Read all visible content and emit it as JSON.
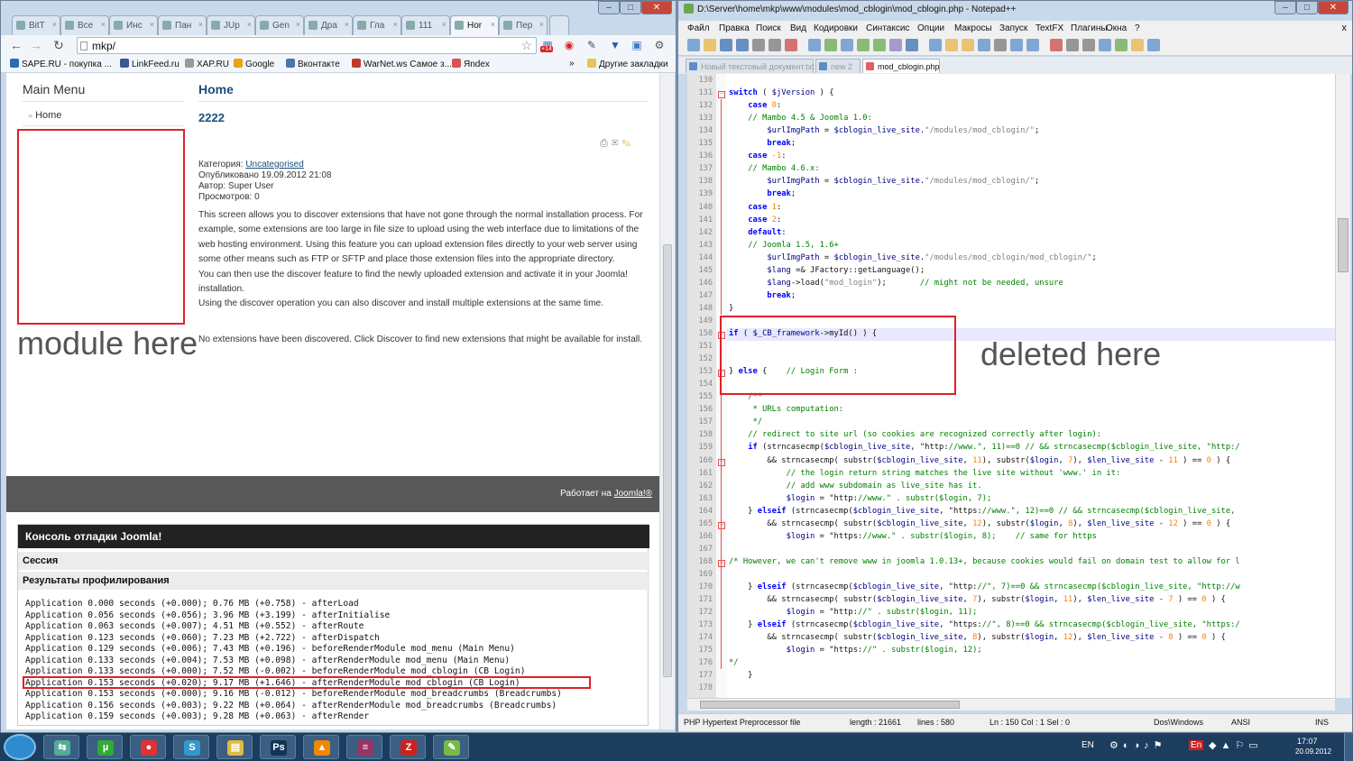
{
  "chrome": {
    "tabs": [
      {
        "label": "BitT"
      },
      {
        "label": "Все"
      },
      {
        "label": "Инс"
      },
      {
        "label": "Пан"
      },
      {
        "label": "JUp"
      },
      {
        "label": "Gen"
      },
      {
        "label": "Дра"
      },
      {
        "label": "Гла"
      },
      {
        "label": "111"
      },
      {
        "label": "Hor"
      },
      {
        "label": "Пер"
      }
    ],
    "url": "mkp/",
    "badge": "+14",
    "bookmarks": [
      {
        "label": "SAPE.RU - покупка ...",
        "color": "#2b6cb0"
      },
      {
        "label": "LinkFeed.ru",
        "color": "#3b5998"
      },
      {
        "label": "XAP.RU",
        "color": "#999999"
      },
      {
        "label": "Google",
        "color": "#e8a317"
      },
      {
        "label": "Вконтакте",
        "color": "#4a76a8"
      },
      {
        "label": "WarNet.ws Самое з...",
        "color": "#c0392b"
      },
      {
        "label": "Яndex",
        "color": "#d9534f"
      }
    ],
    "other_bookmarks": "Другие закладки"
  },
  "joomla": {
    "main_menu_title": "Main Menu",
    "menu_item_home": "Home",
    "module_note": "module here",
    "page_title": "Home",
    "article_title": "2222",
    "category_label": "Категория: ",
    "category_link": "Uncategorised",
    "published": "Опубликовано 19.09.2012 21:08",
    "author": "Автор: Super User",
    "views": "Просмотров: 0",
    "body": [
      "This screen allows you to discover extensions that have not gone through the normal installation process. For example, some extensions are too large in file size to upload using the web interface due to limitations of the web hosting environment. Using this feature you can upload extension files directly to your web server using some other means such as FTP or SFTP and place those extension files into the appropriate directory.",
      "You can then use the discover feature to find the newly uploaded extension and activate it in your Joomla! installation.",
      "Using the discover operation you can also discover and install multiple extensions at the same time."
    ],
    "no_extensions": "No extensions have been discovered. Click Discover to find new extensions that might be available for install.",
    "powered_label": "Работает на ",
    "powered_link": "Joomla!®",
    "debug_title": "Консоль отладки Joomla!",
    "session_label": "Сессия",
    "profile_label": "Результаты профилирования",
    "profile_lines": [
      "Application 0.000 seconds (+0.000); 0.76 MB (+0.758) - afterLoad",
      "Application 0.056 seconds (+0.056); 3.96 MB (+3.199) - afterInitialise",
      "Application 0.063 seconds (+0.007); 4.51 MB (+0.552) - afterRoute",
      "Application 0.123 seconds (+0.060); 7.23 MB (+2.722) - afterDispatch",
      "Application 0.129 seconds (+0.006); 7.43 MB (+0.196) - beforeRenderModule mod_menu (Main Menu)",
      "Application 0.133 seconds (+0.004); 7.53 MB (+0.098) - afterRenderModule mod_menu (Main Menu)",
      "Application 0.133 seconds (+0.000); 7.52 MB (-0.002) - beforeRenderModule mod_cblogin (CB Login)",
      "Application 0.153 seconds (+0.020); 9.17 MB (+1.646) - afterRenderModule mod_cblogin (CB Login)",
      "Application 0.153 seconds (+0.000); 9.16 MB (-0.012) - beforeRenderModule mod_breadcrumbs (Breadcrumbs)",
      "Application 0.156 seconds (+0.003); 9.22 MB (+0.064) - afterRenderModule mod_breadcrumbs (Breadcrumbs)",
      "Application 0.159 seconds (+0.003); 9.28 MB (+0.063) - afterRender"
    ]
  },
  "npp": {
    "title": "D:\\Server\\home\\mkp\\www\\modules\\mod_cblogin\\mod_cblogin.php - Notepad++",
    "menu": [
      "Файл",
      "Правка",
      "Поиск",
      "Вид",
      "Кодировки",
      "Синтаксис",
      "Опции",
      "Макросы",
      "Запуск",
      "TextFX",
      "Плагины",
      "Окна",
      "?"
    ],
    "tabs": [
      "Новый текстовый документ.txt",
      "new 2",
      "mod_cblogin.php"
    ],
    "deleted_note": "deleted here",
    "status": {
      "filetype": "PHP Hypertext Preprocessor file",
      "length": "length : 21661",
      "lines": "lines : 580",
      "position": "Ln : 150    Col : 1    Sel : 0",
      "eol": "Dos\\Windows",
      "encoding": "ANSI",
      "mode": "INS"
    },
    "code": [
      {
        "n": "130",
        "t": ""
      },
      {
        "n": "131",
        "t": "switch ( $jVersion ) {"
      },
      {
        "n": "132",
        "t": "    case 0:"
      },
      {
        "n": "133",
        "t": "    // Mambo 4.5 & Joomla 1.0:"
      },
      {
        "n": "134",
        "t": "        $urlImgPath = $cblogin_live_site.\"/modules/mod_cblogin/\";"
      },
      {
        "n": "135",
        "t": "        break;"
      },
      {
        "n": "136",
        "t": "    case -1:"
      },
      {
        "n": "137",
        "t": "    // Mambo 4.6.x:"
      },
      {
        "n": "138",
        "t": "        $urlImgPath = $cblogin_live_site.\"/modules/mod_cblogin/\";"
      },
      {
        "n": "139",
        "t": "        break;"
      },
      {
        "n": "140",
        "t": "    case 1:"
      },
      {
        "n": "141",
        "t": "    case 2:"
      },
      {
        "n": "142",
        "t": "    default:"
      },
      {
        "n": "143",
        "t": "    // Joomla 1.5, 1.6+"
      },
      {
        "n": "144",
        "t": "        $urlImgPath = $cblogin_live_site.\"/modules/mod_cblogin/mod_cblogin/\";"
      },
      {
        "n": "145",
        "t": "        $lang =& JFactory::getLanguage();"
      },
      {
        "n": "146",
        "t": "        $lang->load(\"mod_login\");       // might not be needed, unsure"
      },
      {
        "n": "147",
        "t": "        break;"
      },
      {
        "n": "148",
        "t": "}"
      },
      {
        "n": "149",
        "t": ""
      },
      {
        "n": "150",
        "t": "if ( $_CB_framework->myId() ) {"
      },
      {
        "n": "151",
        "t": ""
      },
      {
        "n": "152",
        "t": ""
      },
      {
        "n": "153",
        "t": "} else {    // Login Form :"
      },
      {
        "n": "154",
        "t": ""
      },
      {
        "n": "155",
        "t": "    /**"
      },
      {
        "n": "156",
        "t": "     * URLs computation:"
      },
      {
        "n": "157",
        "t": "     */"
      },
      {
        "n": "158",
        "t": "    // redirect to site url (so cookies are recognized correctly after login):"
      },
      {
        "n": "159",
        "t": "    if (strncasecmp($cblogin_live_site, \"http://www.\", 11)==0 // && strncasecmp($cblogin_live_site, \"http:/"
      },
      {
        "n": "160",
        "t": "        && strncasecmp( substr($cblogin_live_site, 11), substr($login, 7), $len_live_site - 11 ) == 0 ) {"
      },
      {
        "n": "161",
        "t": "            // the login return string matches the live site without 'www.' in it:"
      },
      {
        "n": "162",
        "t": "            // add www subdomain as live_site has it."
      },
      {
        "n": "163",
        "t": "            $login = \"http://www.\" . substr($login, 7);"
      },
      {
        "n": "164",
        "t": "    } elseif (strncasecmp($cblogin_live_site, \"https://www.\", 12)==0 // && strncasecmp($cblogin_live_site,"
      },
      {
        "n": "165",
        "t": "        && strncasecmp( substr($cblogin_live_site, 12), substr($login, 8), $len_live_site - 12 ) == 0 ) {"
      },
      {
        "n": "166",
        "t": "            $login = \"https://www.\" . substr($login, 8);    // same for https"
      },
      {
        "n": "167",
        "t": ""
      },
      {
        "n": "168",
        "t": "/* However, we can't remove www in joomla 1.0.13+, because cookies would fail on domain test to allow for l"
      },
      {
        "n": "169",
        "t": ""
      },
      {
        "n": "170",
        "t": "    } elseif (strncasecmp($cblogin_live_site, \"http://\", 7)==0 && strncasecmp($cblogin_live_site, \"http://w"
      },
      {
        "n": "171",
        "t": "        && strncasecmp( substr($cblogin_live_site, 7), substr($login, 11), $len_live_site - 7 ) == 0 ) {"
      },
      {
        "n": "172",
        "t": "            $login = \"http://\" . substr($login, 11);"
      },
      {
        "n": "173",
        "t": "    } elseif (strncasecmp($cblogin_live_site, \"https://\", 8)==0 && strncasecmp($cblogin_live_site, \"https:/"
      },
      {
        "n": "174",
        "t": "        && strncasecmp( substr($cblogin_live_site, 8), substr($login, 12), $len_live_site - 8 ) == 0 ) {"
      },
      {
        "n": "175",
        "t": "            $login = \"https://\" . substr($login, 12);"
      },
      {
        "n": "176",
        "t": "*/"
      },
      {
        "n": "177",
        "t": "    }"
      },
      {
        "n": "178",
        "t": ""
      }
    ]
  },
  "taskbar": {
    "apps": [
      {
        "name": "network-app",
        "glyph": "⇆",
        "color": "#5a9"
      },
      {
        "name": "utorrent-app",
        "glyph": "µ",
        "color": "#3a3"
      },
      {
        "name": "chrome-app",
        "glyph": "●",
        "color": "#d33"
      },
      {
        "name": "skype-app",
        "glyph": "S",
        "color": "#39c"
      },
      {
        "name": "explorer-app",
        "glyph": "▤",
        "color": "#db4"
      },
      {
        "name": "photoshop-app",
        "glyph": "Ps",
        "color": "#135"
      },
      {
        "name": "avast-app",
        "glyph": "▲",
        "color": "#e80"
      },
      {
        "name": "winrar-app",
        "glyph": "≡",
        "color": "#936"
      },
      {
        "name": "filezilla-app",
        "glyph": "Z",
        "color": "#c22"
      },
      {
        "name": "notepadpp-app",
        "glyph": "✎",
        "color": "#7b4"
      }
    ],
    "lang": "EN",
    "kb": "En",
    "time": "17:07",
    "date": "20.09.2012"
  }
}
